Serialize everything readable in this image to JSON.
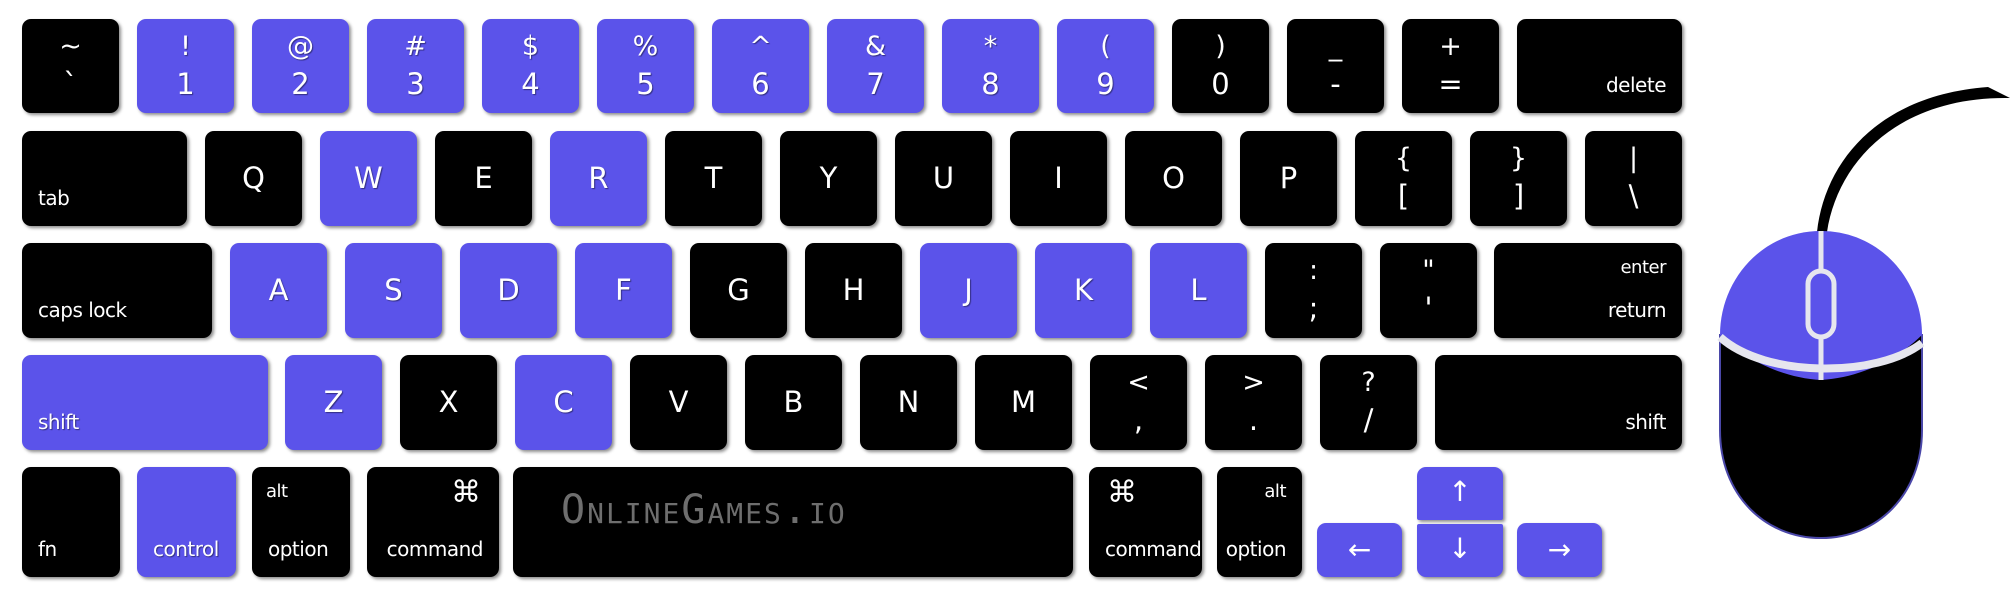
{
  "colors": {
    "highlight": "#5b53ea",
    "key": "#000000",
    "label": "#ffffff",
    "logo": "#6e6e6e",
    "mouse_divider": "#e6e6ee",
    "mouse_outline": "#4a47a8"
  },
  "keyboard": {
    "row1": [
      {
        "top": "~",
        "bottom": "`",
        "highlighted": false
      },
      {
        "top": "!",
        "bottom": "1",
        "highlighted": true
      },
      {
        "top": "@",
        "bottom": "2",
        "highlighted": true
      },
      {
        "top": "#",
        "bottom": "3",
        "highlighted": true
      },
      {
        "top": "$",
        "bottom": "4",
        "highlighted": true
      },
      {
        "top": "%",
        "bottom": "5",
        "highlighted": true
      },
      {
        "top": "^",
        "bottom": "6",
        "highlighted": true
      },
      {
        "top": "&",
        "bottom": "7",
        "highlighted": true
      },
      {
        "top": "*",
        "bottom": "8",
        "highlighted": true
      },
      {
        "top": "(",
        "bottom": "9",
        "highlighted": true
      },
      {
        "top": ")",
        "bottom": "0",
        "highlighted": false
      },
      {
        "top": "_",
        "bottom": "-",
        "highlighted": false
      },
      {
        "top": "+",
        "bottom": "=",
        "highlighted": false
      },
      {
        "label": "delete",
        "highlighted": false
      }
    ],
    "row2": [
      {
        "label": "tab",
        "highlighted": false
      },
      {
        "main": "Q",
        "highlighted": false
      },
      {
        "main": "W",
        "highlighted": true
      },
      {
        "main": "E",
        "highlighted": false
      },
      {
        "main": "R",
        "highlighted": true
      },
      {
        "main": "T",
        "highlighted": false
      },
      {
        "main": "Y",
        "highlighted": false
      },
      {
        "main": "U",
        "highlighted": false
      },
      {
        "main": "I",
        "highlighted": false
      },
      {
        "main": "O",
        "highlighted": false
      },
      {
        "main": "P",
        "highlighted": false
      },
      {
        "top": "{",
        "bottom": "[",
        "highlighted": false
      },
      {
        "top": "}",
        "bottom": "]",
        "highlighted": false
      },
      {
        "top": "|",
        "bottom": "\\",
        "highlighted": false
      }
    ],
    "row3": [
      {
        "label": "caps lock",
        "highlighted": false
      },
      {
        "main": "A",
        "highlighted": true
      },
      {
        "main": "S",
        "highlighted": true
      },
      {
        "main": "D",
        "highlighted": true
      },
      {
        "main": "F",
        "highlighted": true
      },
      {
        "main": "G",
        "highlighted": false
      },
      {
        "main": "H",
        "highlighted": false
      },
      {
        "main": "J",
        "highlighted": true
      },
      {
        "main": "K",
        "highlighted": true
      },
      {
        "main": "L",
        "highlighted": true
      },
      {
        "top": ":",
        "bottom": ";",
        "highlighted": false
      },
      {
        "top": "\"",
        "bottom": "'",
        "highlighted": false
      },
      {
        "label_top": "enter",
        "label": "return",
        "highlighted": false
      }
    ],
    "row4": [
      {
        "label": "shift",
        "highlighted": true
      },
      {
        "main": "Z",
        "highlighted": true
      },
      {
        "main": "X",
        "highlighted": false
      },
      {
        "main": "C",
        "highlighted": true
      },
      {
        "main": "V",
        "highlighted": false
      },
      {
        "main": "B",
        "highlighted": false
      },
      {
        "main": "N",
        "highlighted": false
      },
      {
        "main": "M",
        "highlighted": false
      },
      {
        "top": "<",
        "bottom": ",",
        "highlighted": false
      },
      {
        "top": ">",
        "bottom": ".",
        "highlighted": false
      },
      {
        "top": "?",
        "bottom": "/",
        "highlighted": false
      },
      {
        "label": "shift",
        "highlighted": false
      }
    ],
    "row5": {
      "fn": {
        "label": "fn",
        "highlighted": false
      },
      "control": {
        "label": "control",
        "highlighted": true
      },
      "option_left": {
        "label_top": "alt",
        "label": "option",
        "highlighted": false
      },
      "command_left": {
        "symbol": "⌘",
        "label": "command",
        "highlighted": false
      },
      "space": {
        "logo_text": "OnlineGames.io",
        "highlighted": false
      },
      "command_right": {
        "symbol": "⌘",
        "label": "command",
        "highlighted": false
      },
      "option_right": {
        "label_top": "alt",
        "label": "option",
        "highlighted": false
      },
      "arrow_left": {
        "symbol": "←",
        "highlighted": true
      },
      "arrow_up": {
        "symbol": "↑",
        "highlighted": true
      },
      "arrow_down": {
        "symbol": "↓",
        "highlighted": true
      },
      "arrow_right": {
        "symbol": "→",
        "highlighted": true
      }
    }
  },
  "mouse": {
    "left_button_highlighted": true,
    "right_button_highlighted": true,
    "body_highlighted": false
  }
}
